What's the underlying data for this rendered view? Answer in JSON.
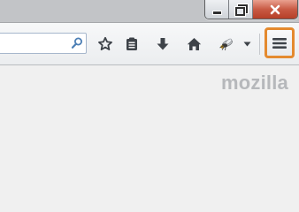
{
  "window": {
    "controls": [
      {
        "name": "minimize",
        "icon": "minimize-icon"
      },
      {
        "name": "restore",
        "icon": "restore-icon"
      },
      {
        "name": "close",
        "icon": "close-icon",
        "glyph": "✕"
      }
    ]
  },
  "toolbar": {
    "search": {
      "value": "",
      "placeholder": "",
      "icon": "search-icon"
    },
    "buttons": [
      {
        "name": "bookmark-star",
        "icon": "star-icon"
      },
      {
        "name": "bookmarks-list",
        "icon": "bookmarks-list-icon"
      },
      {
        "name": "downloads",
        "icon": "download-arrow-icon"
      },
      {
        "name": "home",
        "icon": "home-icon"
      },
      {
        "name": "addon",
        "icon": "addon-insect-icon"
      },
      {
        "name": "addon-dropdown",
        "icon": "dropdown-arrow-icon"
      },
      {
        "name": "open-menu",
        "icon": "hamburger-menu-icon",
        "highlighted": true
      }
    ]
  },
  "content": {
    "brand": "mozilla"
  },
  "colors": {
    "highlight": "#e48a2f",
    "close_button": "#c95a44",
    "icon": "#3e4349",
    "brand_text": "#b6b8bb"
  }
}
